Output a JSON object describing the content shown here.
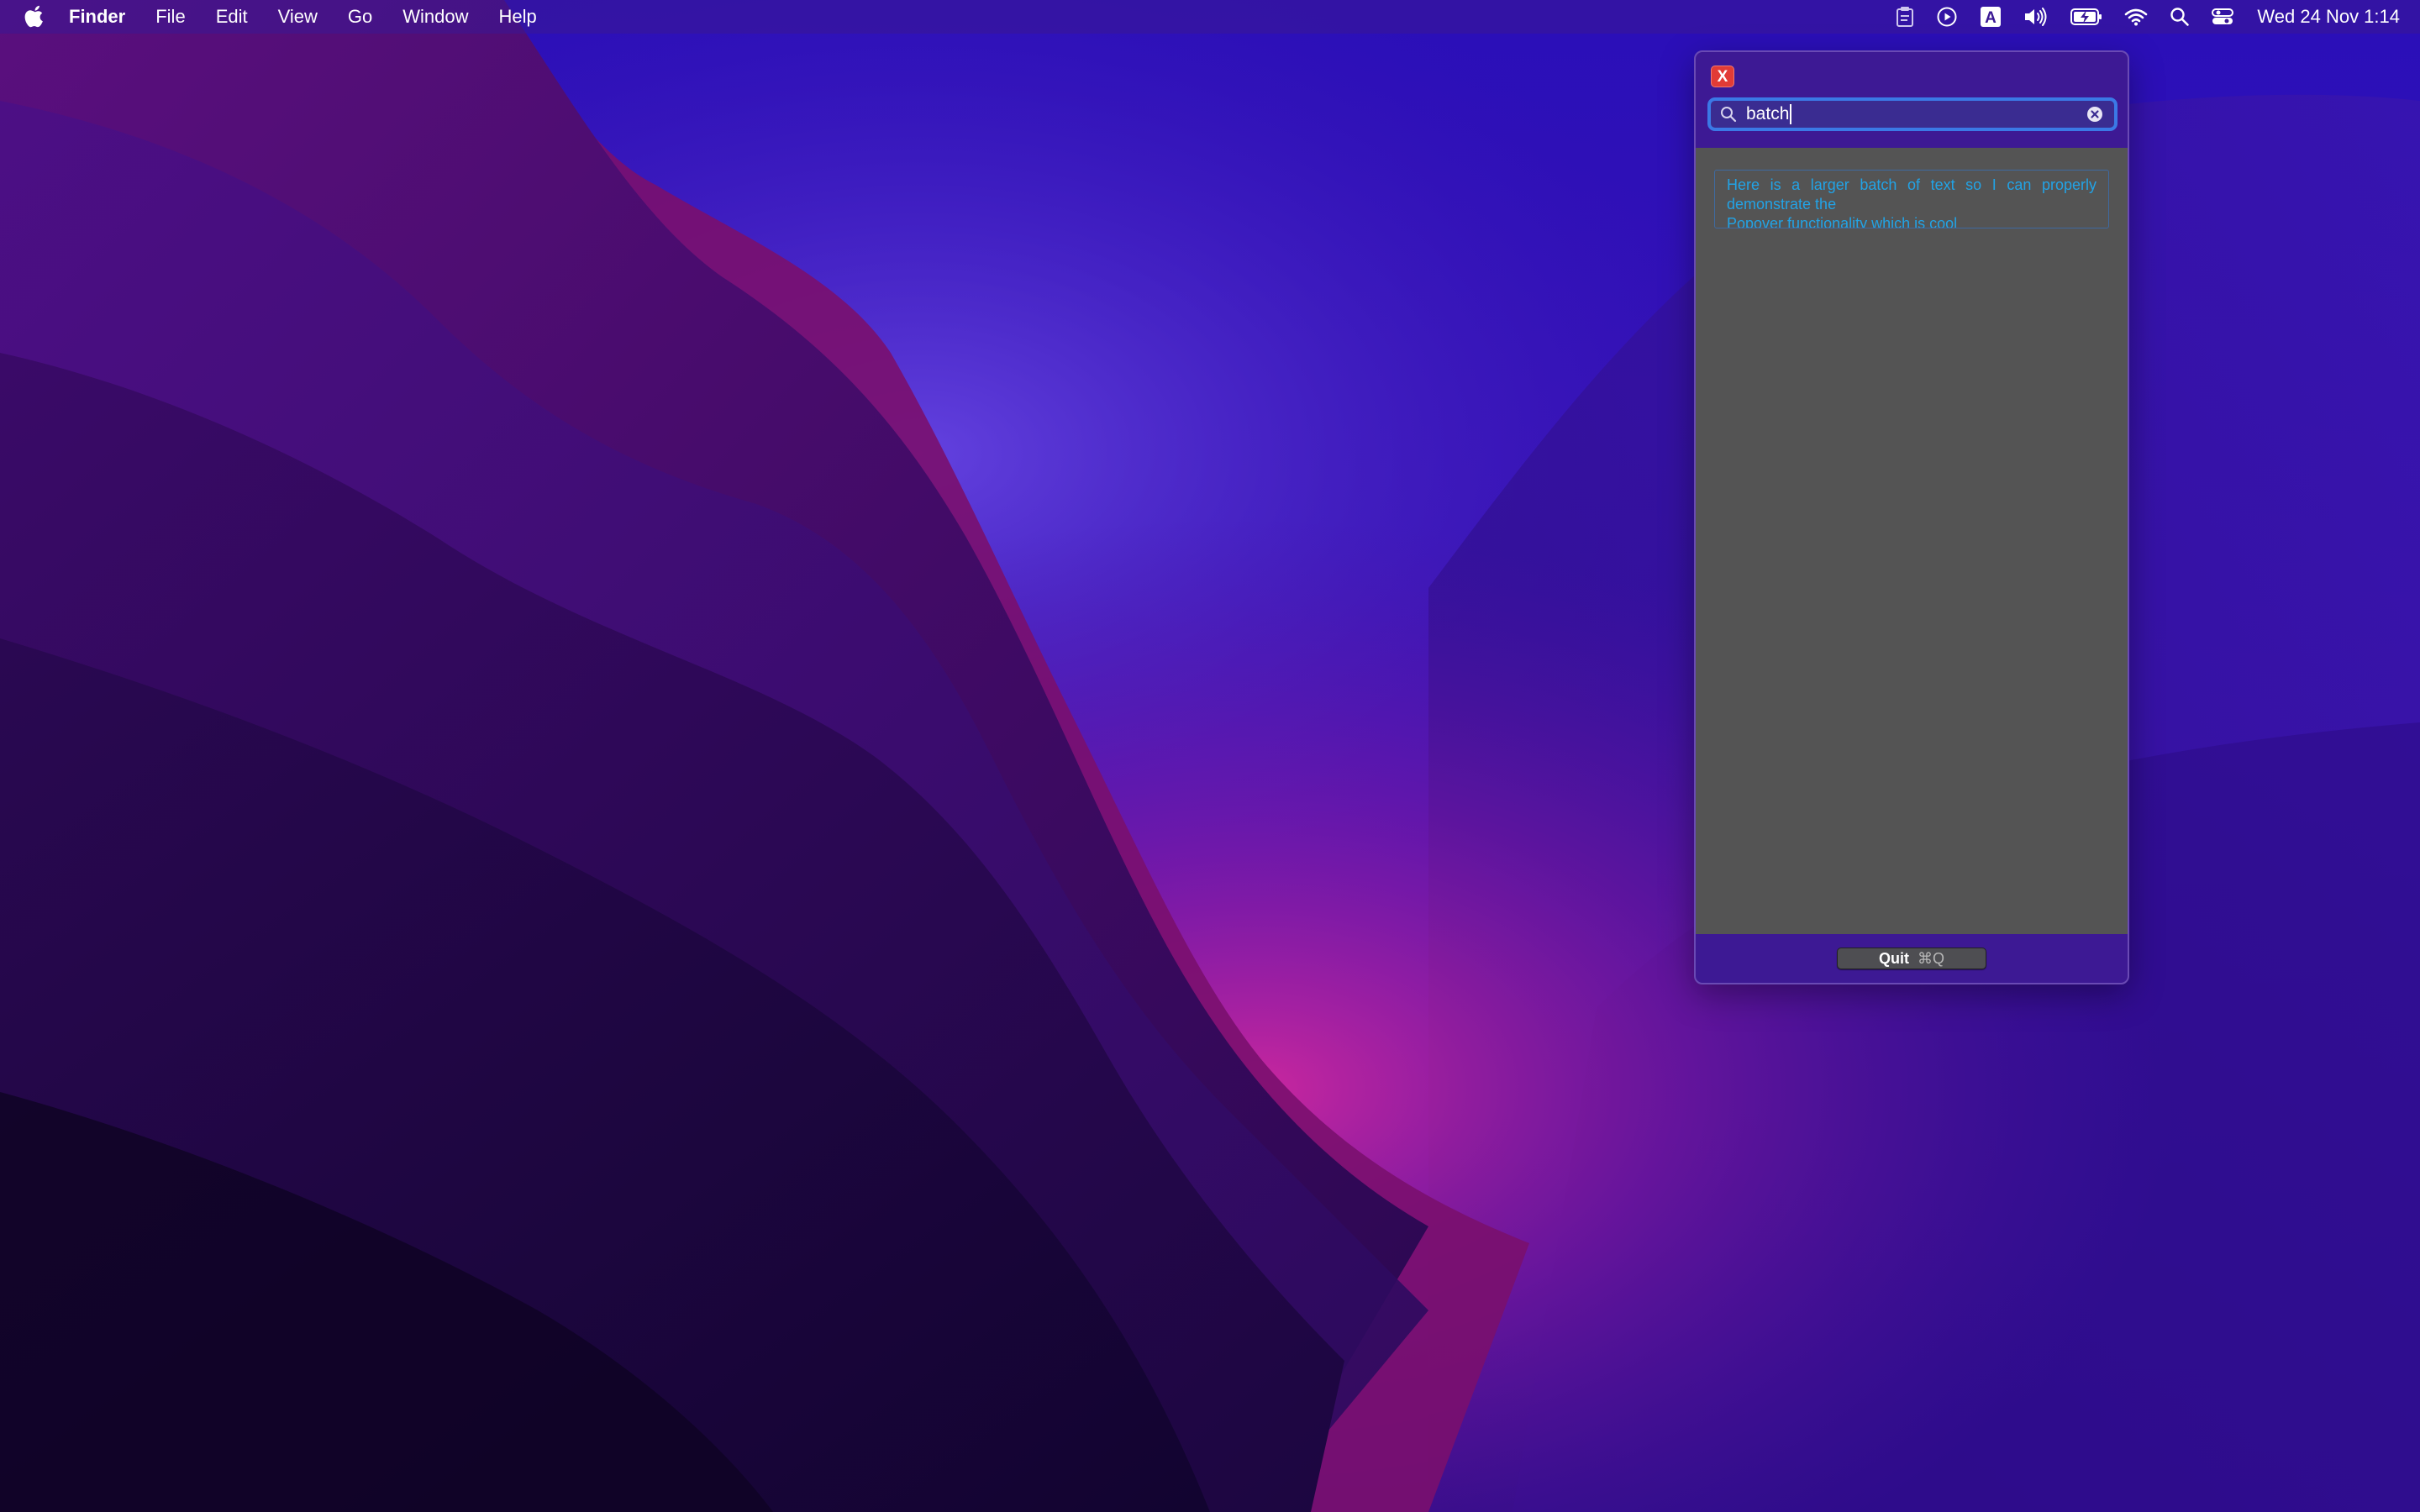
{
  "menubar": {
    "app_name": "Finder",
    "menus": [
      "File",
      "Edit",
      "View",
      "Go",
      "Window",
      "Help"
    ],
    "status_icons": [
      "clipboard-icon",
      "play-circle-icon",
      "input-source-icon",
      "volume-icon",
      "battery-charging-icon",
      "wifi-icon",
      "spotlight-search-icon",
      "control-center-icon"
    ],
    "input_source_letter": "A",
    "clock": "Wed 24 Nov  1:14"
  },
  "popover": {
    "close_label": "X",
    "search": {
      "value": "batch"
    },
    "results": [
      {
        "lines": [
          "Here is a larger batch of text so I can properly",
          "demonstrate the",
          "Popover functionality which is cool"
        ]
      }
    ],
    "quit": {
      "label": "Quit",
      "shortcut": "⌘Q"
    }
  },
  "colors": {
    "menubar": "#3a1894",
    "popover_bg": "#3d1994",
    "results_bg": "#545454",
    "result_text": "#22a3e6",
    "search_focus_ring": "#3b79e6",
    "close_button": "#e23b36"
  }
}
